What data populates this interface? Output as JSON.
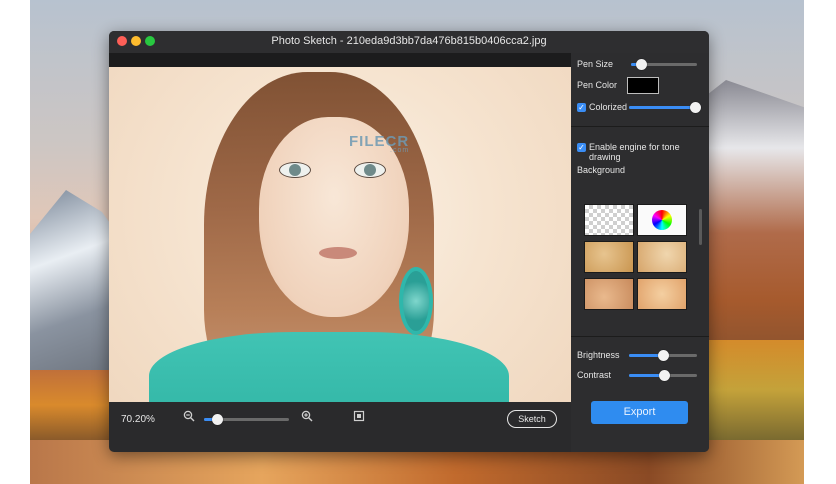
{
  "window": {
    "title": "Photo Sketch - 210eda9d3bb7da476b815b0406cca2.jpg"
  },
  "canvas": {
    "watermark": {
      "brand": "FILECR",
      "domain": ".com"
    }
  },
  "bottom_bar": {
    "zoom_label": "70.20%",
    "zoom_level": 0.15,
    "sketch_label": "Sketch",
    "icons": [
      "zoom-out-icon",
      "zoom-in-icon",
      "fit-to-window-icon"
    ]
  },
  "panel": {
    "pen_size": {
      "label": "Pen Size",
      "value": 0.15
    },
    "pen_color": {
      "label": "Pen Color",
      "color": "#000000"
    },
    "colorized": {
      "label": "Colorized",
      "checked": true,
      "value": 1.0
    },
    "tone_engine": {
      "label": "Enable engine for tone drawing",
      "checked": true
    },
    "background": {
      "label": "Background",
      "thumbnails": [
        "transparent",
        "color-wheel",
        "paper-1",
        "paper-2",
        "paper-3",
        "paper-4"
      ]
    },
    "brightness": {
      "label": "Brightness",
      "value": 0.5
    },
    "contrast": {
      "label": "Contrast",
      "value": 0.52
    },
    "export_label": "Export"
  },
  "colors": {
    "accent": "#3a8df5",
    "export": "#2f8cf0",
    "window_bg": "#2a2a2c"
  }
}
